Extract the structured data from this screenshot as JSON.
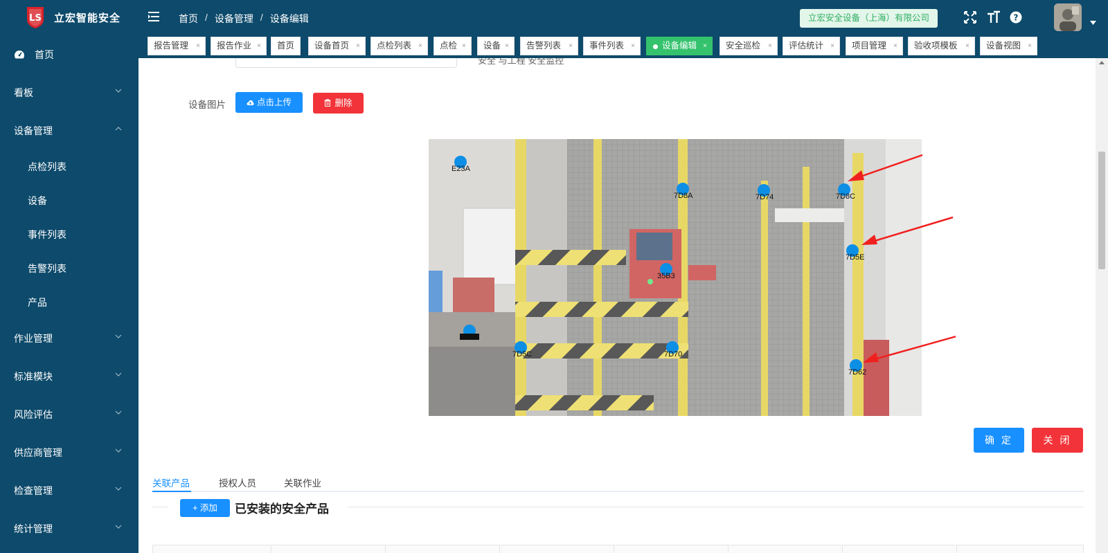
{
  "app": {
    "title": "立宏智能安全"
  },
  "sidebar": {
    "items": [
      {
        "label": "首页",
        "icon": "dashboard-icon"
      },
      {
        "label": "看板"
      },
      {
        "label": "设备管理",
        "expanded": true
      },
      {
        "label": "点检列表"
      },
      {
        "label": "设备"
      },
      {
        "label": "事件列表"
      },
      {
        "label": "告警列表"
      },
      {
        "label": "产品"
      },
      {
        "label": "作业管理"
      },
      {
        "label": "标准模块"
      },
      {
        "label": "风险评估"
      },
      {
        "label": "供应商管理"
      },
      {
        "label": "检查管理"
      },
      {
        "label": "统计管理"
      }
    ]
  },
  "header": {
    "breadcrumb": [
      "首页",
      "设备管理",
      "设备编辑"
    ],
    "separator": "/",
    "company": "立宏安全设备（上海）有限公司"
  },
  "tabs": [
    {
      "label": "报告管理"
    },
    {
      "label": "报告作业"
    },
    {
      "label": "首页"
    },
    {
      "label": "设备首页"
    },
    {
      "label": "点检列表"
    },
    {
      "label": "点检"
    },
    {
      "label": "设备"
    },
    {
      "label": "告警列表"
    },
    {
      "label": "事件列表"
    },
    {
      "label": "设备编辑",
      "active": true
    },
    {
      "label": "安全巡检"
    },
    {
      "label": "评估统计"
    },
    {
      "label": "项目管理"
    },
    {
      "label": "验收项模板"
    },
    {
      "label": "设备视图"
    }
  ],
  "tab_close": "×",
  "form": {
    "partial_text": "安全 与工程 安全监控",
    "image_label": "设备图片",
    "upload_label": "点击上传",
    "delete_label": "删除"
  },
  "markers": [
    {
      "label": "E23A"
    },
    {
      "label": "7D8A"
    },
    {
      "label": "7D74"
    },
    {
      "label": "7D8C"
    },
    {
      "label": "7D5E"
    },
    {
      "label": "35B3"
    },
    {
      "label": "7D5C"
    },
    {
      "label": "7D70"
    },
    {
      "label": "7D62"
    }
  ],
  "actions": {
    "confirm_label": "确 定",
    "close_label": "关 闭"
  },
  "bottom_tabs": [
    {
      "label": "关联产品",
      "active": true
    },
    {
      "label": "授权人员"
    },
    {
      "label": "关联作业"
    }
  ],
  "section": {
    "add_label": "+ 添加",
    "title": "已安装的安全产品"
  },
  "colors": {
    "sidebar_bg": "#0d4a6b",
    "primary": "#1890ff",
    "danger": "#f2343a",
    "active_tab": "#34c26c",
    "marker": "#0d8fe6",
    "arrow": "#f0201e"
  }
}
